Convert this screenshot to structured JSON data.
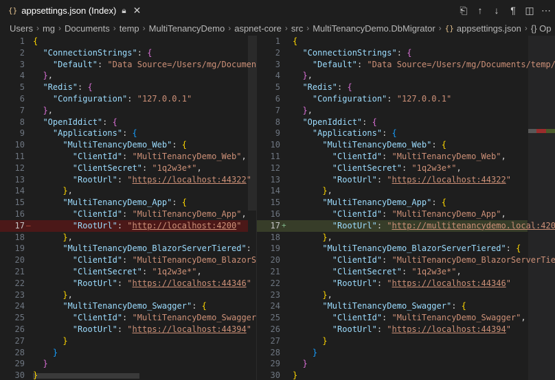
{
  "tab": {
    "icon": "{}",
    "title": "appsettings.json (Index)",
    "lock_icon": "lock-icon",
    "close_icon": "close-icon"
  },
  "actions": [
    "open-changes-icon",
    "arrow-up-icon",
    "arrow-down-icon",
    "pilcrow-icon",
    "split-editor-icon",
    "more-icon"
  ],
  "breadcrumb": [
    "Users",
    "mg",
    "Documents",
    "temp",
    "MultiTenancyDemo",
    "aspnet-core",
    "src",
    "MultiTenancyDemo.DbMigrator"
  ],
  "breadcrumb_file": "appsettings.json",
  "breadcrumb_tail": "{} Op",
  "colors": {
    "bg": "#1e1e1e",
    "key": "#9cdcfe",
    "string": "#ce9178",
    "deleted": "#4b1818",
    "added": "#373d29"
  },
  "left": {
    "lines": [
      "1",
      "2",
      "3",
      "4",
      "5",
      "6",
      "7",
      "8",
      "9",
      "10",
      "11",
      "12",
      "13",
      "14",
      "15",
      "16",
      "17",
      "18",
      "19",
      "20",
      "21",
      "22",
      "23",
      "24",
      "25",
      "26",
      "27",
      "28",
      "29",
      "30"
    ],
    "code": [
      [
        [
          "b1",
          "{"
        ]
      ],
      [
        [
          "p",
          "  "
        ],
        [
          "k",
          "\"ConnectionStrings\""
        ],
        [
          "p",
          ": "
        ],
        [
          "b2",
          "{"
        ]
      ],
      [
        [
          "p",
          "    "
        ],
        [
          "k",
          "\"Default\""
        ],
        [
          "p",
          ": "
        ],
        [
          "s",
          "\"Data Source=/Users/mg/Documents/"
        ]
      ],
      [
        [
          "p",
          "  "
        ],
        [
          "b2",
          "}"
        ],
        [
          "p",
          ","
        ]
      ],
      [
        [
          "p",
          "  "
        ],
        [
          "k",
          "\"Redis\""
        ],
        [
          "p",
          ": "
        ],
        [
          "b2",
          "{"
        ]
      ],
      [
        [
          "p",
          "    "
        ],
        [
          "k",
          "\"Configuration\""
        ],
        [
          "p",
          ": "
        ],
        [
          "s",
          "\"127.0.0.1\""
        ]
      ],
      [
        [
          "p",
          "  "
        ],
        [
          "b2",
          "}"
        ],
        [
          "p",
          ","
        ]
      ],
      [
        [
          "p",
          "  "
        ],
        [
          "k",
          "\"OpenIddict\""
        ],
        [
          "p",
          ": "
        ],
        [
          "b2",
          "{"
        ]
      ],
      [
        [
          "p",
          "    "
        ],
        [
          "k",
          "\"Applications\""
        ],
        [
          "p",
          ": "
        ],
        [
          "b3",
          "{"
        ]
      ],
      [
        [
          "p",
          "      "
        ],
        [
          "k",
          "\"MultiTenancyDemo_Web\""
        ],
        [
          "p",
          ": "
        ],
        [
          "b1",
          "{"
        ]
      ],
      [
        [
          "p",
          "        "
        ],
        [
          "k",
          "\"ClientId\""
        ],
        [
          "p",
          ": "
        ],
        [
          "s",
          "\"MultiTenancyDemo_Web\""
        ],
        [
          "p",
          ","
        ]
      ],
      [
        [
          "p",
          "        "
        ],
        [
          "k",
          "\"ClientSecret\""
        ],
        [
          "p",
          ": "
        ],
        [
          "s",
          "\"1q2w3e*\""
        ],
        [
          "p",
          ","
        ]
      ],
      [
        [
          "p",
          "        "
        ],
        [
          "k",
          "\"RootUrl\""
        ],
        [
          "p",
          ": "
        ],
        [
          "s",
          "\""
        ],
        [
          "su",
          "https://localhost:44322"
        ],
        [
          "s",
          "\""
        ]
      ],
      [
        [
          "p",
          "      "
        ],
        [
          "b1",
          "}"
        ],
        [
          "p",
          ","
        ]
      ],
      [
        [
          "p",
          "      "
        ],
        [
          "k",
          "\"MultiTenancyDemo_App\""
        ],
        [
          "p",
          ": "
        ],
        [
          "b1",
          "{"
        ]
      ],
      [
        [
          "p",
          "        "
        ],
        [
          "k",
          "\"ClientId\""
        ],
        [
          "p",
          ": "
        ],
        [
          "s",
          "\"MultiTenancyDemo_App\""
        ],
        [
          "p",
          ","
        ]
      ],
      [
        [
          "p",
          "        "
        ],
        [
          "k",
          "\"RootUrl\""
        ],
        [
          "p",
          ": "
        ],
        [
          "s",
          "\""
        ],
        [
          "su",
          "http://localhost:4200"
        ],
        [
          "s",
          "\""
        ]
      ],
      [
        [
          "p",
          "      "
        ],
        [
          "b1",
          "}"
        ],
        [
          "p",
          ","
        ]
      ],
      [
        [
          "p",
          "      "
        ],
        [
          "k",
          "\"MultiTenancyDemo_BlazorServerTiered\""
        ],
        [
          "p",
          ": "
        ],
        [
          "b1",
          "{"
        ]
      ],
      [
        [
          "p",
          "        "
        ],
        [
          "k",
          "\"ClientId\""
        ],
        [
          "p",
          ": "
        ],
        [
          "s",
          "\"MultiTenancyDemo_BlazorServ"
        ]
      ],
      [
        [
          "p",
          "        "
        ],
        [
          "k",
          "\"ClientSecret\""
        ],
        [
          "p",
          ": "
        ],
        [
          "s",
          "\"1q2w3e*\""
        ],
        [
          "p",
          ","
        ]
      ],
      [
        [
          "p",
          "        "
        ],
        [
          "k",
          "\"RootUrl\""
        ],
        [
          "p",
          ": "
        ],
        [
          "s",
          "\""
        ],
        [
          "su",
          "https://localhost:44346"
        ],
        [
          "s",
          "\""
        ]
      ],
      [
        [
          "p",
          "      "
        ],
        [
          "b1",
          "}"
        ],
        [
          "p",
          ","
        ]
      ],
      [
        [
          "p",
          "      "
        ],
        [
          "k",
          "\"MultiTenancyDemo_Swagger\""
        ],
        [
          "p",
          ": "
        ],
        [
          "b1",
          "{"
        ]
      ],
      [
        [
          "p",
          "        "
        ],
        [
          "k",
          "\"ClientId\""
        ],
        [
          "p",
          ": "
        ],
        [
          "s",
          "\"MultiTenancyDemo_Swagger\""
        ],
        [
          "p",
          ","
        ]
      ],
      [
        [
          "p",
          "        "
        ],
        [
          "k",
          "\"RootUrl\""
        ],
        [
          "p",
          ": "
        ],
        [
          "s",
          "\""
        ],
        [
          "su",
          "https://localhost:44394"
        ],
        [
          "s",
          "\""
        ]
      ],
      [
        [
          "p",
          "      "
        ],
        [
          "b1",
          "}"
        ]
      ],
      [
        [
          "p",
          "    "
        ],
        [
          "b3",
          "}"
        ]
      ],
      [
        [
          "p",
          "  "
        ],
        [
          "b2",
          "}"
        ]
      ],
      [
        [
          "b1",
          "}"
        ]
      ]
    ],
    "changed_line": 17
  },
  "right": {
    "code": [
      [
        [
          "b1",
          "{"
        ]
      ],
      [
        [
          "p",
          "  "
        ],
        [
          "k",
          "\"ConnectionStrings\""
        ],
        [
          "p",
          ": "
        ],
        [
          "b2",
          "{"
        ]
      ],
      [
        [
          "p",
          "    "
        ],
        [
          "k",
          "\"Default\""
        ],
        [
          "p",
          ": "
        ],
        [
          "s",
          "\"Data Source=/Users/mg/Documents/temp/"
        ]
      ],
      [
        [
          "p",
          "  "
        ],
        [
          "b2",
          "}"
        ],
        [
          "p",
          ","
        ]
      ],
      [
        [
          "p",
          "  "
        ],
        [
          "k",
          "\"Redis\""
        ],
        [
          "p",
          ": "
        ],
        [
          "b2",
          "{"
        ]
      ],
      [
        [
          "p",
          "    "
        ],
        [
          "k",
          "\"Configuration\""
        ],
        [
          "p",
          ": "
        ],
        [
          "s",
          "\"127.0.0.1\""
        ]
      ],
      [
        [
          "p",
          "  "
        ],
        [
          "b2",
          "}"
        ],
        [
          "p",
          ","
        ]
      ],
      [
        [
          "p",
          "  "
        ],
        [
          "k",
          "\"OpenIddict\""
        ],
        [
          "p",
          ": "
        ],
        [
          "b2",
          "{"
        ]
      ],
      [
        [
          "p",
          "    "
        ],
        [
          "k",
          "\"Applications\""
        ],
        [
          "p",
          ": "
        ],
        [
          "b3",
          "{"
        ]
      ],
      [
        [
          "p",
          "      "
        ],
        [
          "k",
          "\"MultiTenancyDemo_Web\""
        ],
        [
          "p",
          ": "
        ],
        [
          "b1",
          "{"
        ]
      ],
      [
        [
          "p",
          "        "
        ],
        [
          "k",
          "\"ClientId\""
        ],
        [
          "p",
          ": "
        ],
        [
          "s",
          "\"MultiTenancyDemo_Web\""
        ],
        [
          "p",
          ","
        ]
      ],
      [
        [
          "p",
          "        "
        ],
        [
          "k",
          "\"ClientSecret\""
        ],
        [
          "p",
          ": "
        ],
        [
          "s",
          "\"1q2w3e*\""
        ],
        [
          "p",
          ","
        ]
      ],
      [
        [
          "p",
          "        "
        ],
        [
          "k",
          "\"RootUrl\""
        ],
        [
          "p",
          ": "
        ],
        [
          "s",
          "\""
        ],
        [
          "su",
          "https://localhost:44322"
        ],
        [
          "s",
          "\""
        ]
      ],
      [
        [
          "p",
          "      "
        ],
        [
          "b1",
          "}"
        ],
        [
          "p",
          ","
        ]
      ],
      [
        [
          "p",
          "      "
        ],
        [
          "k",
          "\"MultiTenancyDemo_App\""
        ],
        [
          "p",
          ": "
        ],
        [
          "b1",
          "{"
        ]
      ],
      [
        [
          "p",
          "        "
        ],
        [
          "k",
          "\"ClientId\""
        ],
        [
          "p",
          ": "
        ],
        [
          "s",
          "\"MultiTenancyDemo_App\""
        ],
        [
          "p",
          ","
        ]
      ],
      [
        [
          "p",
          "        "
        ],
        [
          "k",
          "\"RootUrl\""
        ],
        [
          "p",
          ": "
        ],
        [
          "s",
          "\""
        ],
        [
          "su",
          "http://multitenancydemo.local:420"
        ]
      ],
      [
        [
          "p",
          "      "
        ],
        [
          "b1",
          "}"
        ],
        [
          "p",
          ","
        ]
      ],
      [
        [
          "p",
          "      "
        ],
        [
          "k",
          "\"MultiTenancyDemo_BlazorServerTiered\""
        ],
        [
          "p",
          ": "
        ],
        [
          "b1",
          "{"
        ]
      ],
      [
        [
          "p",
          "        "
        ],
        [
          "k",
          "\"ClientId\""
        ],
        [
          "p",
          ": "
        ],
        [
          "s",
          "\"MultiTenancyDemo_BlazorServerTie"
        ]
      ],
      [
        [
          "p",
          "        "
        ],
        [
          "k",
          "\"ClientSecret\""
        ],
        [
          "p",
          ": "
        ],
        [
          "s",
          "\"1q2w3e*\""
        ],
        [
          "p",
          ","
        ]
      ],
      [
        [
          "p",
          "        "
        ],
        [
          "k",
          "\"RootUrl\""
        ],
        [
          "p",
          ": "
        ],
        [
          "s",
          "\""
        ],
        [
          "su",
          "https://localhost:44346"
        ],
        [
          "s",
          "\""
        ]
      ],
      [
        [
          "p",
          "      "
        ],
        [
          "b1",
          "}"
        ],
        [
          "p",
          ","
        ]
      ],
      [
        [
          "p",
          "      "
        ],
        [
          "k",
          "\"MultiTenancyDemo_Swagger\""
        ],
        [
          "p",
          ": "
        ],
        [
          "b1",
          "{"
        ]
      ],
      [
        [
          "p",
          "        "
        ],
        [
          "k",
          "\"ClientId\""
        ],
        [
          "p",
          ": "
        ],
        [
          "s",
          "\"MultiTenancyDemo_Swagger\""
        ],
        [
          "p",
          ","
        ]
      ],
      [
        [
          "p",
          "        "
        ],
        [
          "k",
          "\"RootUrl\""
        ],
        [
          "p",
          ": "
        ],
        [
          "s",
          "\""
        ],
        [
          "su",
          "https://localhost:44394"
        ],
        [
          "s",
          "\""
        ]
      ],
      [
        [
          "p",
          "      "
        ],
        [
          "b1",
          "}"
        ]
      ],
      [
        [
          "p",
          "    "
        ],
        [
          "b3",
          "}"
        ]
      ],
      [
        [
          "p",
          "  "
        ],
        [
          "b2",
          "}"
        ]
      ],
      [
        [
          "b1",
          "}"
        ]
      ]
    ],
    "changed_line": 17
  }
}
